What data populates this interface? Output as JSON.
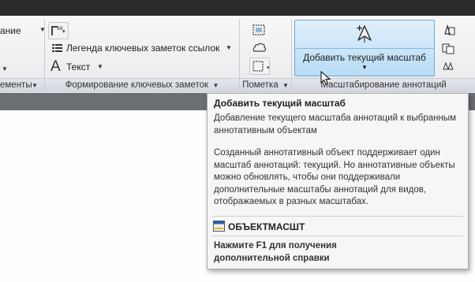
{
  "ribbon": {
    "left_cut": {
      "item1": "ание",
      "item2": "ементы"
    },
    "leaders": {
      "legend_label": "Легенда ключевых заметок ссылок",
      "text_label": "Текст",
      "panel_label": "Формирование ключевых заметок"
    },
    "markup": {
      "panel_label": "Пометка"
    },
    "annotation": {
      "add_scale_label": "Добавить текущий масштаб",
      "panel_label": "Масштабирование аннотаций"
    }
  },
  "tooltip": {
    "title": "Добавить текущий масштаб",
    "description": "Добавление текущего масштаба аннотаций к выбранным аннотативным объектам",
    "details": "Созданный аннотативный объект поддерживает один масштаб аннотаций: текущий. Но аннотативные объекты можно обновлять, чтобы они поддерживали дополнительные масштабы аннотаций для видов, отображаемых в разных масштабах.",
    "command": "ОБЪЕКТМАСШТ",
    "help": "Нажмите F1 для получения дополнительной справки"
  },
  "colors": {
    "accent": "#b8dcf5",
    "accent_border": "#6ea7d6",
    "topbar": "#2b2b2b",
    "strip": "#6b6e73"
  },
  "icons": [
    "dropdown-arrow-icon",
    "text-a-icon",
    "legend-list-icon",
    "dimension-icon",
    "add-scale-icon",
    "markup-icon",
    "cursor-pointer-icon",
    "command-icon"
  ]
}
